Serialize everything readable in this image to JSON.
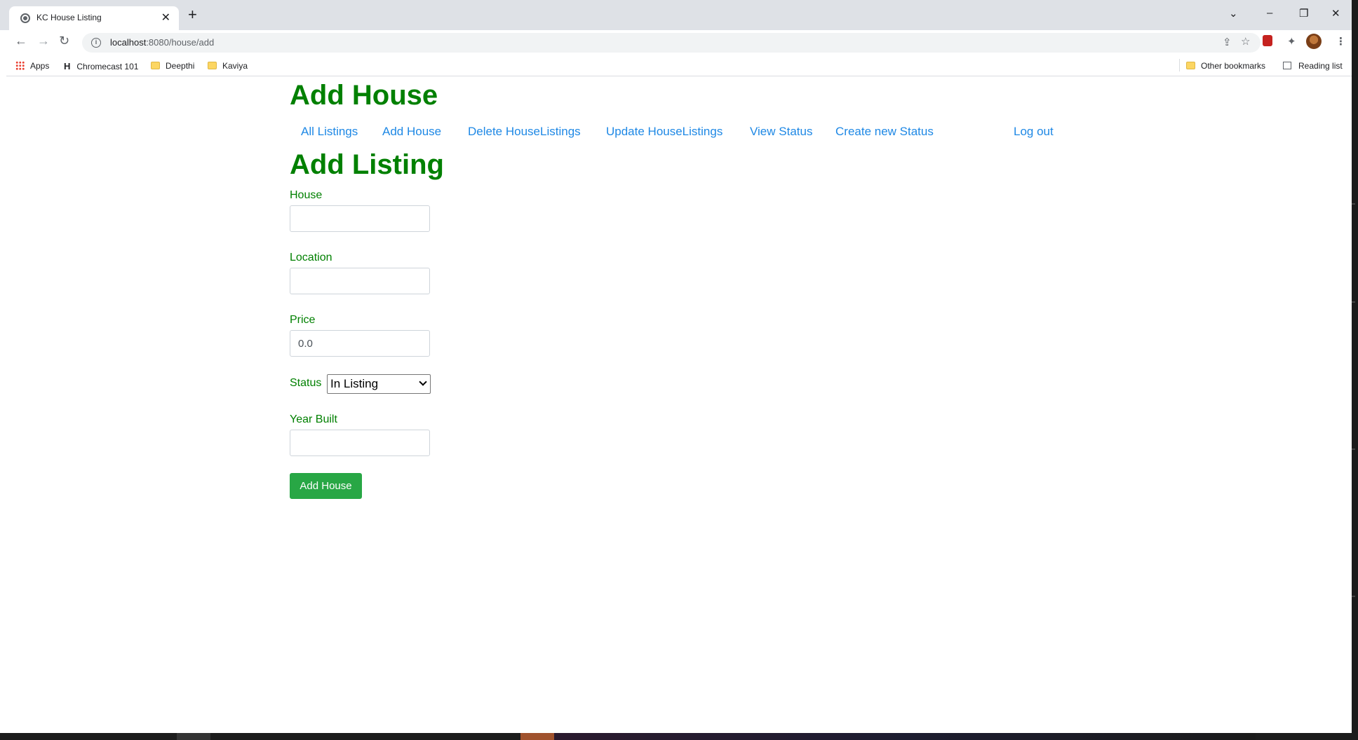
{
  "browser": {
    "tab_title": "KC House Listing",
    "tab_close": "✕",
    "new_tab": "+",
    "window_controls": {
      "menu": "⌄",
      "minimize": "–",
      "restore": "❐",
      "close": "✕"
    },
    "url_host": "localhost",
    "url_path": ":8080/house/add",
    "bookmarks": {
      "apps": "Apps",
      "chromecast": "Chromecast 101",
      "deepthi": "Deepthi",
      "kaviya": "Kaviya",
      "other": "Other bookmarks",
      "reading": "Reading list"
    }
  },
  "page": {
    "title": "Add House",
    "nav": {
      "all_listings": "All Listings",
      "add_house": "Add House",
      "delete": "Delete HouseListings",
      "update": "Update HouseListings",
      "view_status": "View Status",
      "create_status": "Create new Status",
      "logout": "Log out"
    },
    "form_title": "Add Listing",
    "form": {
      "house_label": "House",
      "house_value": "",
      "location_label": "Location",
      "location_value": "",
      "price_label": "Price",
      "price_value": "0.0",
      "status_label": "Status",
      "status_selected": "In Listing",
      "year_label": "Year Built",
      "year_value": "",
      "submit_label": "Add House"
    },
    "colors": {
      "heading": "#008000",
      "link": "#1e88e5",
      "button": "#28a745"
    }
  }
}
